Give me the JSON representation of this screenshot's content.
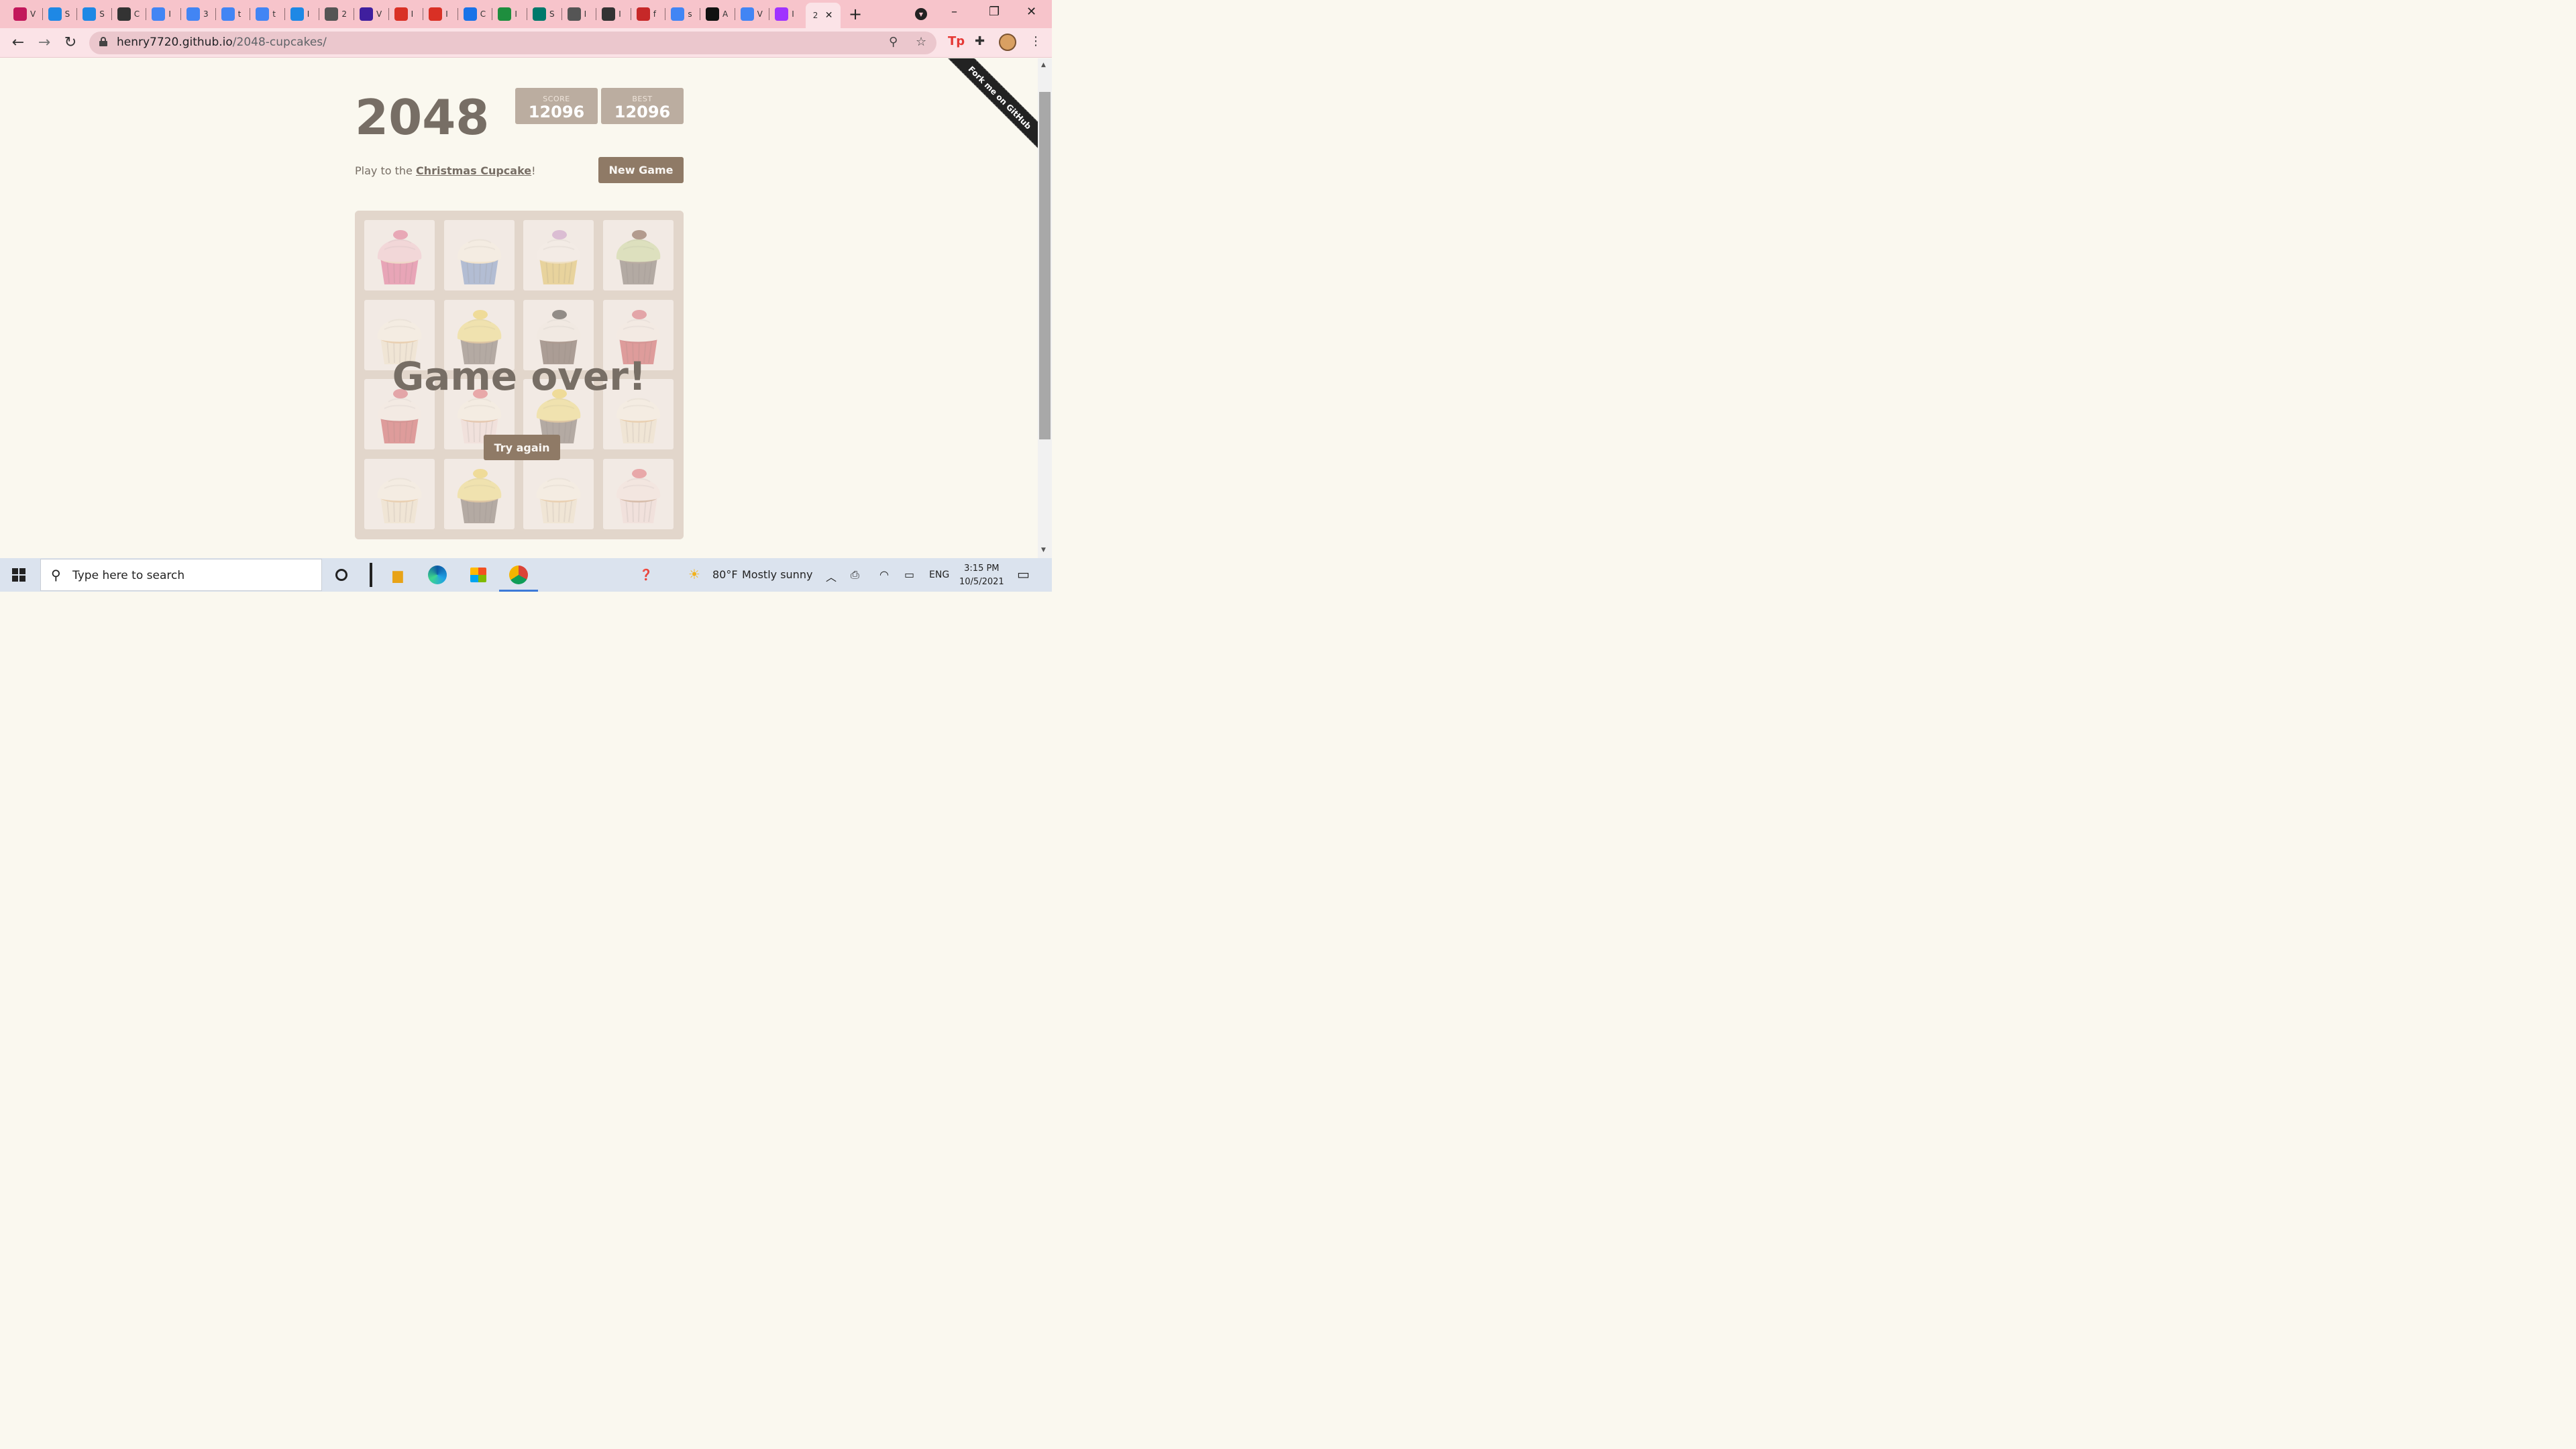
{
  "browser": {
    "tabs": [
      {
        "label": "V",
        "icon": "wave-app-icon",
        "color": "#c2185b"
      },
      {
        "label": "S",
        "icon": "google-drive-icon",
        "color": "#1e88e5"
      },
      {
        "label": "S",
        "icon": "google-drive-icon",
        "color": "#1e88e5"
      },
      {
        "label": "C",
        "icon": "contact-card-icon",
        "color": "#333333"
      },
      {
        "label": "I",
        "icon": "google-docs-icon",
        "color": "#4285f4"
      },
      {
        "label": "3",
        "icon": "google-docs-icon",
        "color": "#4285f4"
      },
      {
        "label": "t",
        "icon": "google-docs-icon",
        "color": "#4285f4"
      },
      {
        "label": "t",
        "icon": "google-docs-icon",
        "color": "#4285f4"
      },
      {
        "label": "I",
        "icon": "google-drive-icon",
        "color": "#1e88e5"
      },
      {
        "label": "2",
        "icon": "globe-icon",
        "color": "#555555"
      },
      {
        "label": "V",
        "icon": "mail-icon",
        "color": "#3f1f9e"
      },
      {
        "label": "I",
        "icon": "gmail-icon",
        "color": "#d93025"
      },
      {
        "label": "I",
        "icon": "gmail-icon",
        "color": "#d93025"
      },
      {
        "label": "C",
        "icon": "calendar-icon",
        "color": "#1a73e8"
      },
      {
        "label": "I",
        "icon": "classroom-icon",
        "color": "#1e8e3e"
      },
      {
        "label": "S",
        "icon": "compass-icon",
        "color": "#00796b"
      },
      {
        "label": "I",
        "icon": "globe-icon",
        "color": "#555555"
      },
      {
        "label": "I",
        "icon": "shield-icon",
        "color": "#333333"
      },
      {
        "label": "f",
        "icon": "wordreference-icon",
        "color": "#c62828"
      },
      {
        "label": "s",
        "icon": "google-icon",
        "color": "#4285f4"
      },
      {
        "label": "A",
        "icon": "s-letter-icon",
        "color": "#111111"
      },
      {
        "label": "V",
        "icon": "google-docs-icon",
        "color": "#4285f4"
      },
      {
        "label": "I",
        "icon": "messenger-icon",
        "color": "#a033ff"
      },
      {
        "label": "2",
        "icon": "game-2048-icon",
        "color": "#776e65",
        "active": true
      }
    ],
    "new_tab": "+",
    "url_host": "henry7720.github.io",
    "url_path": "/2048-cupcakes/",
    "window_controls": {
      "minimize": "–",
      "restore": "❐",
      "close": "✕"
    }
  },
  "game": {
    "title": "2048",
    "score_label": "SCORE",
    "score": "12096",
    "best_label": "BEST",
    "best": "12096",
    "intro_prefix": "Play to the ",
    "intro_link": "Christmas Cupcake",
    "intro_suffix": "!",
    "new_game": "New Game",
    "game_over": "Game over!",
    "try_again": "Try again",
    "ribbon": "Fork me on GitHub",
    "tiles": [
      {
        "frosting": "#f6c8d6",
        "wrapper": "#e05a8d",
        "cake": "#f0c7b0",
        "topping": "#e0608a"
      },
      {
        "frosting": "#fbf6ea",
        "wrapper": "#6c8fc9",
        "cake": "#f3e1b8",
        "topping": ""
      },
      {
        "frosting": "#f8f4f1",
        "wrapper": "#e0bf52",
        "cake": "#f0d9a0",
        "topping": "#c48ec9"
      },
      {
        "frosting": "#c7dc9c",
        "wrapper": "#6b6560",
        "cake": "#7a6a5e",
        "topping": "#6b4331"
      },
      {
        "frosting": "#fbf6ea",
        "wrapper": "#f2e6cf",
        "cake": "#e3b57c",
        "topping": ""
      },
      {
        "frosting": "#f1e07a",
        "wrapper": "#6d6560",
        "cake": "#c79e5d",
        "topping": "#f0d04a"
      },
      {
        "frosting": "#f4f0ec",
        "wrapper": "#5a4840",
        "cake": "#5b4035",
        "topping": "#222222"
      },
      {
        "frosting": "#f8f1ee",
        "wrapper": "#c9454e",
        "cake": "#b8363f",
        "topping": "#d45a6a"
      },
      {
        "frosting": "#f8f1ee",
        "wrapper": "#c9454e",
        "cake": "#b8363f",
        "topping": "#d45a6a"
      },
      {
        "frosting": "#fbf6ea",
        "wrapper": "#f4dede",
        "cake": "#d9a47a",
        "topping": "#e0606e"
      },
      {
        "frosting": "#f1e07a",
        "wrapper": "#6d6560",
        "cake": "#c79e5d",
        "topping": "#f0d04a"
      },
      {
        "frosting": "#fbf6ea",
        "wrapper": "#f2e6cf",
        "cake": "#e3b57c",
        "topping": ""
      },
      {
        "frosting": "#fbf6ea",
        "wrapper": "#f2e6cf",
        "cake": "#e3b57c",
        "topping": ""
      },
      {
        "frosting": "#f1e07a",
        "wrapper": "#6d6560",
        "cake": "#c79e5d",
        "topping": "#f0d04a"
      },
      {
        "frosting": "#fbf6ea",
        "wrapper": "#f2e6cf",
        "cake": "#e3b57c",
        "topping": ""
      },
      {
        "frosting": "#f8e8e6",
        "wrapper": "#f4dede",
        "cake": "#b88a6c",
        "topping": "#e0606e"
      }
    ]
  },
  "taskbar": {
    "search_placeholder": "Type here to search",
    "weather_temp": "80°F",
    "weather_desc": "Mostly sunny",
    "language": "ENG",
    "time": "3:15 PM",
    "date": "10/5/2021"
  }
}
